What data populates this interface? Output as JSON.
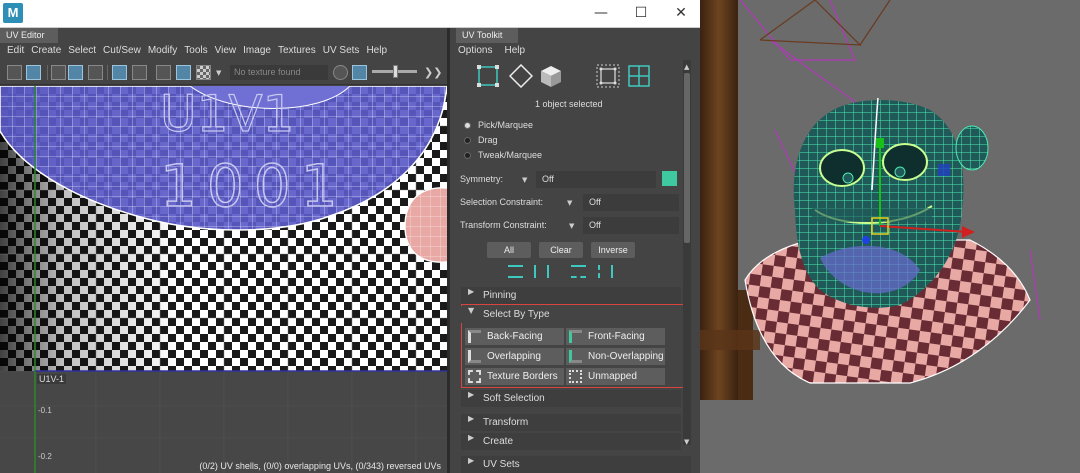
{
  "window": {
    "logo_letter": "M",
    "minimize": "—",
    "maximize": "☐",
    "close": "✕"
  },
  "uv_editor": {
    "panel_title": "UV Editor",
    "menu": [
      "Edit",
      "Create",
      "Select",
      "Cut/Sew",
      "Modify",
      "Tools",
      "View",
      "Image",
      "Textures",
      "UV Sets",
      "Help"
    ],
    "texture_field": "No texture found",
    "tile_label": "U1V-1",
    "axis_labels": [
      "-0.1",
      "-0.2"
    ],
    "status": "(0/2) UV shells, (0/0) overlapping UVs, (0/343) reversed UVs"
  },
  "uv_toolkit": {
    "panel_title": "UV Toolkit",
    "menu": [
      "Options",
      "Help"
    ],
    "mode_icons": [
      "uv-component-icon",
      "uv-edge-icon",
      "uv-shell-icon",
      "uv-shell-select-icon",
      "uv-grid-icon"
    ],
    "selection_info": "1 object selected",
    "selection_modes": [
      "Pick/Marquee",
      "Drag",
      "Tweak/Marquee"
    ],
    "selected_mode": "Pick/Marquee",
    "symmetry": {
      "label": "Symmetry:",
      "value": "Off"
    },
    "selection_constraint": {
      "label": "Selection Constraint:",
      "value": "Off"
    },
    "transform_constraint": {
      "label": "Transform Constraint:",
      "value": "Off"
    },
    "buttons": {
      "all": "All",
      "clear": "Clear",
      "inverse": "Inverse"
    },
    "sections": {
      "pinning": "Pinning",
      "select_by_type": "Select By Type",
      "soft_selection": "Soft Selection",
      "transform": "Transform",
      "create": "Create",
      "uv_sets": "UV Sets"
    },
    "select_by_type_buttons": [
      "Back-Facing",
      "Front-Facing",
      "Overlapping",
      "Non-Overlapping",
      "Texture Borders",
      "Unmapped"
    ],
    "highlight_color": "#d9443e"
  },
  "colors": {
    "uv_blue": "#5a5ac8",
    "wire_teal": "#4ee8b0",
    "checker_dark": "#6a2c34",
    "checker_light": "#e8a8a4"
  }
}
